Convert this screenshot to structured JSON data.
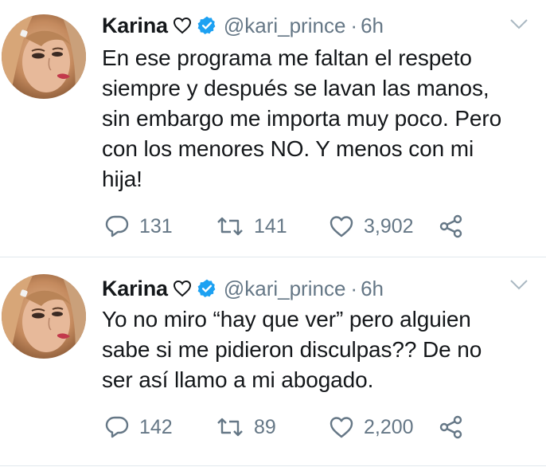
{
  "tweets": [
    {
      "display_name": "Karina",
      "handle": "@kari_prince",
      "separator": "·",
      "time": "6h",
      "text": "En ese programa me faltan el respeto\nsiempre y después se lavan las manos,\nsin embargo me importa muy poco. Pero\ncon los menores NO. Y menos con mi\nhija!",
      "replies": "131",
      "retweets": "141",
      "likes": "3,902"
    },
    {
      "display_name": "Karina",
      "handle": "@kari_prince",
      "separator": "·",
      "time": "6h",
      "text": "Yo no miro “hay que ver” pero alguien\nsabe si me pidieron disculpas?? De no\nser así llamo a mi abogado.",
      "replies": "142",
      "retweets": "89",
      "likes": "2,200"
    }
  ],
  "icons": {
    "name_emoji": "white-heart-icon",
    "verified": "verified-badge-icon",
    "caret": "chevron-down-icon",
    "reply": "reply-icon",
    "retweet": "retweet-icon",
    "like": "heart-icon",
    "share": "share-icon"
  },
  "colors": {
    "text": "#14171a",
    "secondary": "#657786",
    "verified": "#1da1f2",
    "divider": "#e1e8ed"
  }
}
